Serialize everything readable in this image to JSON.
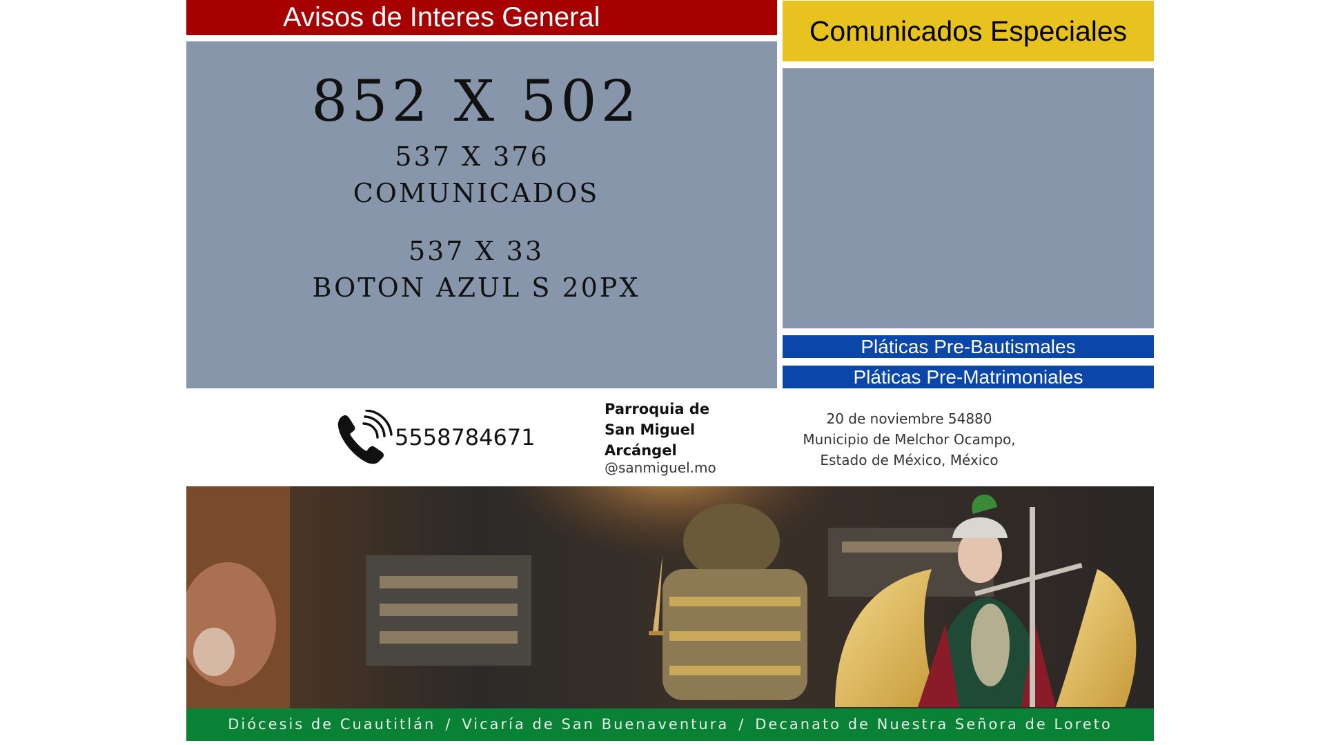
{
  "avisos_header": {
    "title": "Avisos de Interes General"
  },
  "comunicados_header": {
    "title": "Comunicados Especiales"
  },
  "main_panel": {
    "line1": "852 X 502",
    "line2": "537 X 376",
    "line3": "COMUNICADOS",
    "line4": "537 X 33",
    "line5": "BOTON AZUL S 20PX"
  },
  "buttons": {
    "bautismales": "Pláticas Pre-Bautismales",
    "matrimoniales": "Pláticas Pre-Matrimoniales"
  },
  "contact": {
    "phone": "5558784671",
    "parish_line1": "Parroquia de",
    "parish_line2": "San Miguel",
    "parish_line3": "Arcángel",
    "handle": "@sanmiguel.mo",
    "address_line1": "20 de noviembre 54880",
    "address_line2": "Municipio de Melchor Ocampo,",
    "address_line3": "Estado de México, México"
  },
  "footer": {
    "diocesis": "Diócesis de Cuautitlán",
    "vicaria": "Vicaría de San Buenaventura",
    "decanato": "Decanato de Nuestra Señora de Loreto",
    "separator": "/"
  },
  "colors": {
    "red": "#a60000",
    "yellow": "#e8c21f",
    "slate": "#8796aa",
    "blue": "#0b47a8",
    "green": "#0a8236"
  },
  "icons": {
    "phone": "phone-ringing-icon"
  }
}
